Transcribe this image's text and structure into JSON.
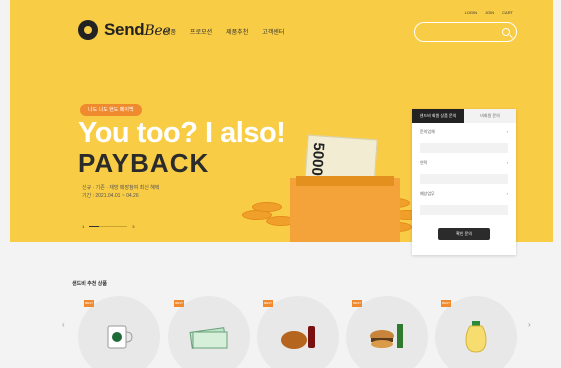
{
  "brand": {
    "logo_text": "Send",
    "logo_script": "Bee"
  },
  "header": {
    "nav": [
      "제품",
      "프로모션",
      "제품추천",
      "고객센터"
    ],
    "utility": [
      "LOGIN",
      "JOIN",
      "CART"
    ],
    "search": {
      "placeholder": "",
      "value": ""
    }
  },
  "hero": {
    "badge": "나도 나도 현도 페이백",
    "headline": "You too? I also!",
    "subhead": "PAYBACK",
    "desc_line1": "신규 · 기존 · 재방 매장참여 최신 혜택",
    "desc_line2": "기간 : 2021.04.01 ~ 04.26",
    "pager_current": "1",
    "pager_total": "3",
    "bill_number": "50000"
  },
  "login_panel": {
    "tabs": [
      "샌드비 회원 상품 문의",
      "비회원 문의"
    ],
    "fields": [
      {
        "label": "문의업체",
        "value": ""
      },
      {
        "label": "연락",
        "value": ""
      },
      {
        "label": "예상업무",
        "value": ""
      }
    ],
    "submit_label": "확인 문의"
  },
  "products_section": {
    "title": "샌드비 추천 상품",
    "items": [
      {
        "tag": "BEST",
        "icon": "coffee-mug-icon"
      },
      {
        "tag": "BEST",
        "icon": "money-bills-icon"
      },
      {
        "tag": "BEST",
        "icon": "chicken-drink-icon"
      },
      {
        "tag": "BEST",
        "icon": "burger-set-icon"
      },
      {
        "tag": "BEST",
        "icon": "banana-milk-icon"
      }
    ]
  },
  "colors": {
    "hero_bg": "#f8cc45",
    "accent": "#f08a2f",
    "dark": "#222222"
  }
}
